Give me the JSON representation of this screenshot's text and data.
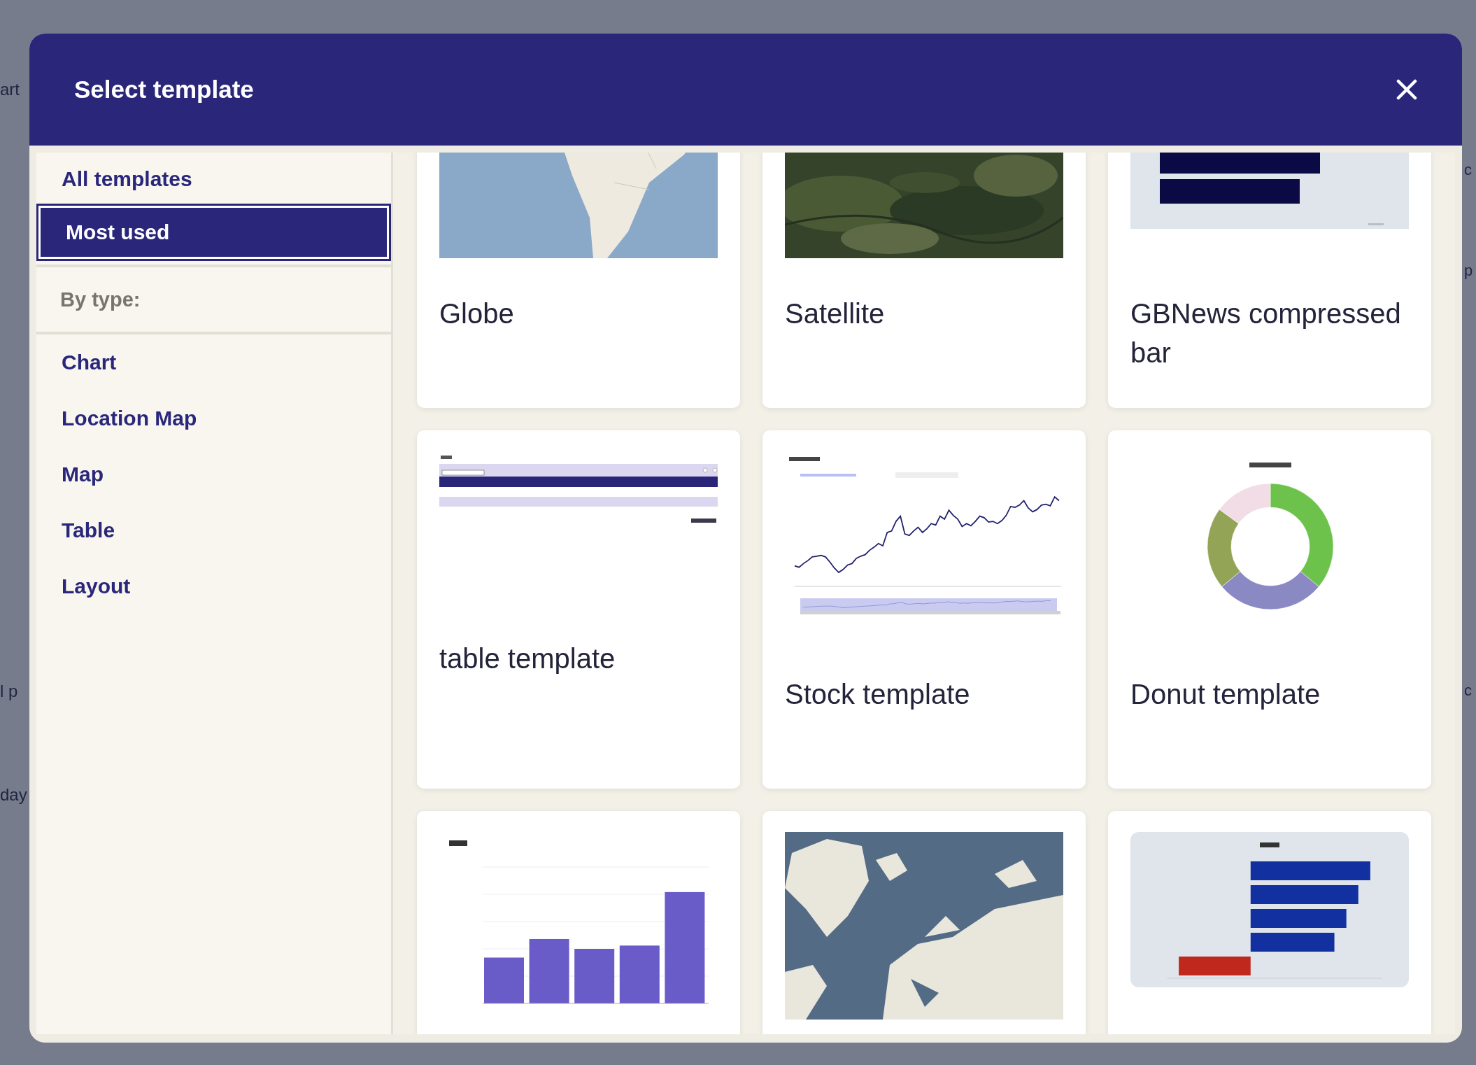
{
  "backdrop": {
    "fragments": [
      "art",
      "l p",
      "day",
      "c",
      "p",
      "c"
    ]
  },
  "dialog": {
    "title": "Select template"
  },
  "sidebar": {
    "top_items": [
      {
        "label": "All templates",
        "selected": false
      },
      {
        "label": "Most used",
        "selected": true
      }
    ],
    "type_heading": "By type:",
    "type_items": [
      {
        "label": "Chart",
        "selected": false
      },
      {
        "label": "Location Map",
        "selected": false
      },
      {
        "label": "Map",
        "selected": false
      },
      {
        "label": "Table",
        "selected": false
      },
      {
        "label": "Layout",
        "selected": false
      }
    ]
  },
  "templates": [
    {
      "title": "Globe",
      "thumbnail": {
        "kind": "map"
      }
    },
    {
      "title": "Satellite",
      "thumbnail": {
        "kind": "satellite"
      }
    },
    {
      "title": "GBNews compressed bar",
      "thumbnail": {
        "kind": "compressed-bars"
      }
    },
    {
      "title": "table template",
      "thumbnail": {
        "kind": "table"
      }
    },
    {
      "title": "Stock template",
      "thumbnail": {
        "kind": "stock"
      }
    },
    {
      "title": "Donut template",
      "thumbnail": {
        "kind": "donut"
      }
    },
    {
      "thumbnail": {
        "kind": "columns"
      }
    },
    {
      "thumbnail": {
        "kind": "world-map"
      }
    },
    {
      "thumbnail": {
        "kind": "bars"
      }
    }
  ]
}
